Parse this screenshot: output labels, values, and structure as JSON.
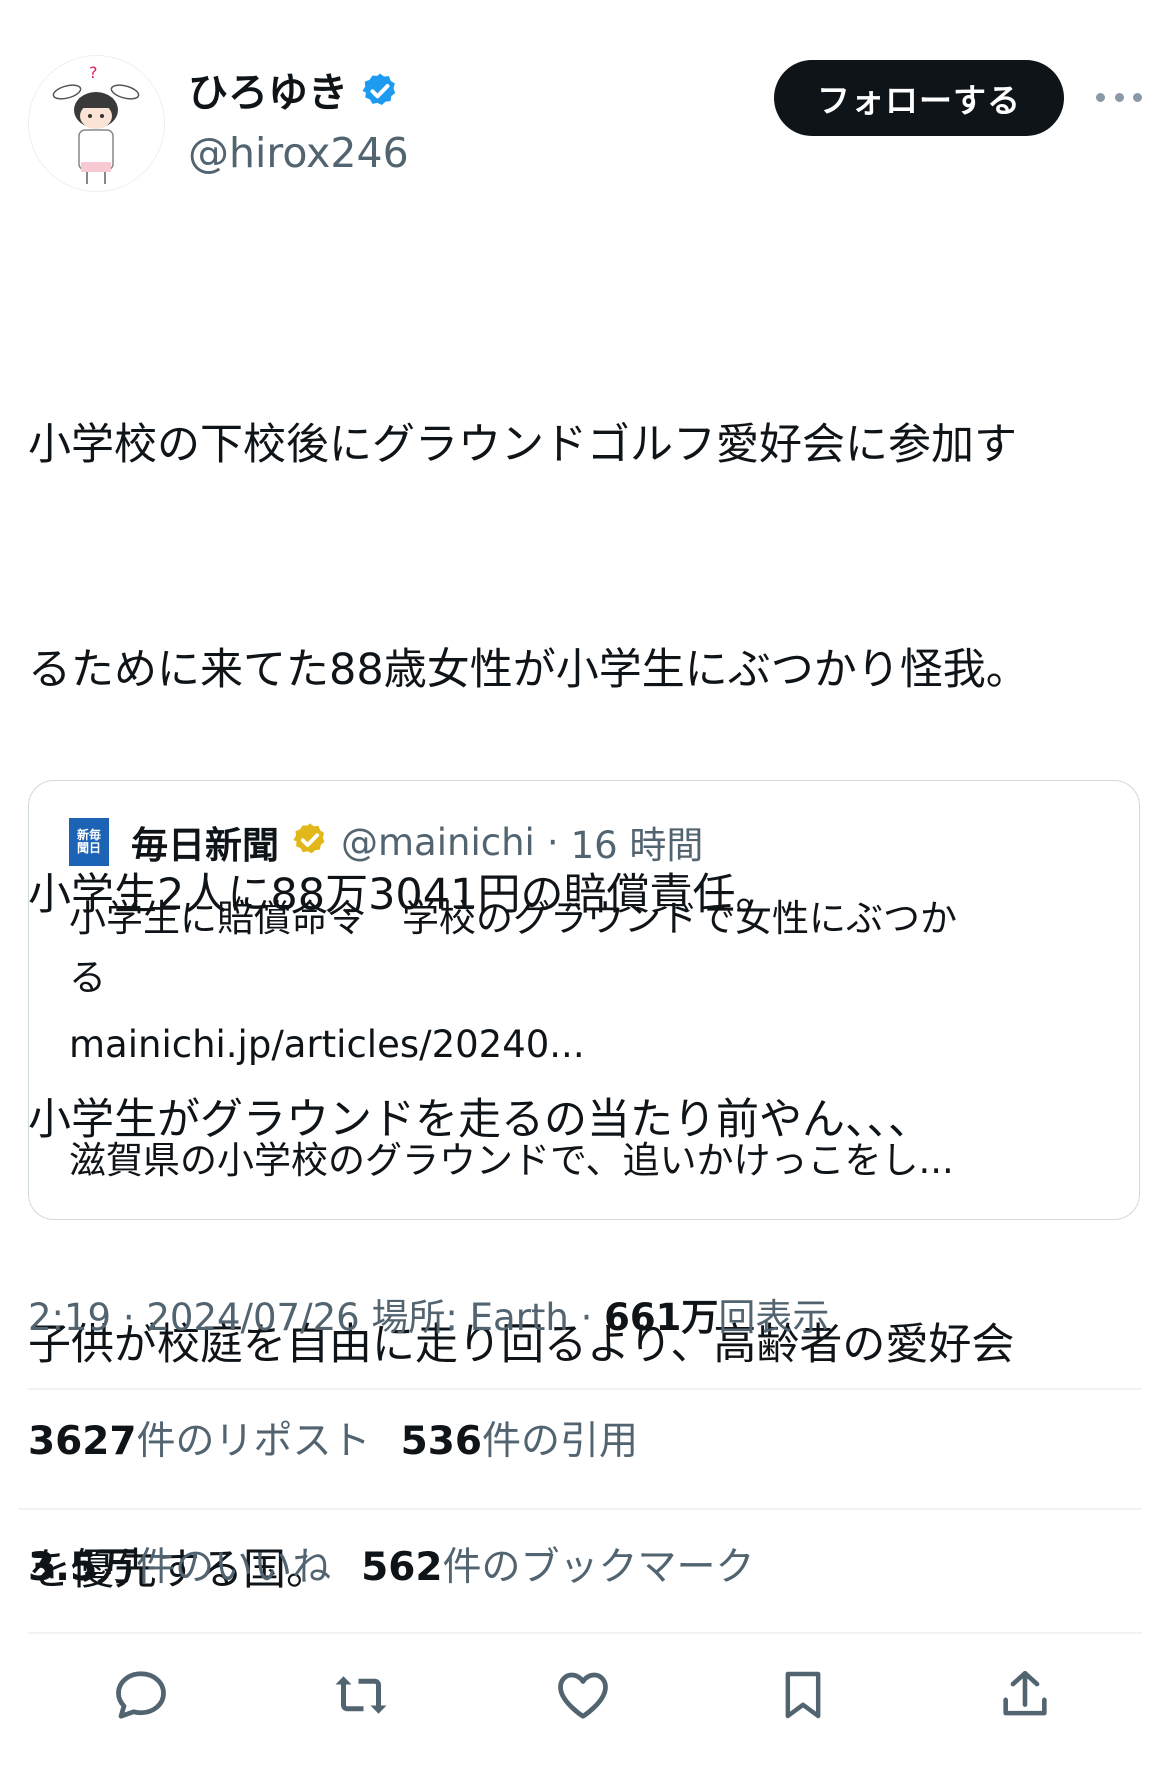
{
  "author": {
    "display_name": "ひろゆき",
    "handle": "@hirox246",
    "verified_color": "#1d9bf0"
  },
  "follow_label": "フォローする",
  "tweet_lines": [
    "小学校の下校後にグラウンドゴルフ愛好会に参加す",
    "るために来てた88歳女性が小学生にぶつかり怪我。",
    "小学生2人に88万3041円の賠償責任。",
    "小学生がグラウンドを走るの当たり前やん、、、",
    "子供が校庭を自由に走り回るより、高齢者の愛好会",
    "を優先する国。"
  ],
  "quote": {
    "logo_text": "新毎\n聞日",
    "name": "毎日新聞",
    "handle": "@mainichi",
    "time": "16 時間",
    "badge_color": "#e2b719",
    "body_lines": [
      "小学生に賠償命令　学校のグラウンドで女性にぶつか",
      "る"
    ],
    "link": "mainichi.jp/articles/20240...",
    "snippet": "滋賀県の小学校のグラウンドで、追いかけっこをし..."
  },
  "meta": {
    "time": "2:19",
    "date": "2024/07/26",
    "location": "場所: Earth",
    "views_count": "661万",
    "views_label": "回表示"
  },
  "stats": {
    "reposts_count": "3627",
    "reposts_label": "件のリポスト",
    "quotes_count": "536",
    "quotes_label": "件の引用",
    "likes_count": "3.5万",
    "likes_label": "件のいいね",
    "bookmarks_count": "562",
    "bookmarks_label": "件のブックマーク"
  },
  "colors": {
    "text": "#0f1419",
    "secondary": "#536471",
    "border": "#cfd9de",
    "icon": "#536471"
  }
}
